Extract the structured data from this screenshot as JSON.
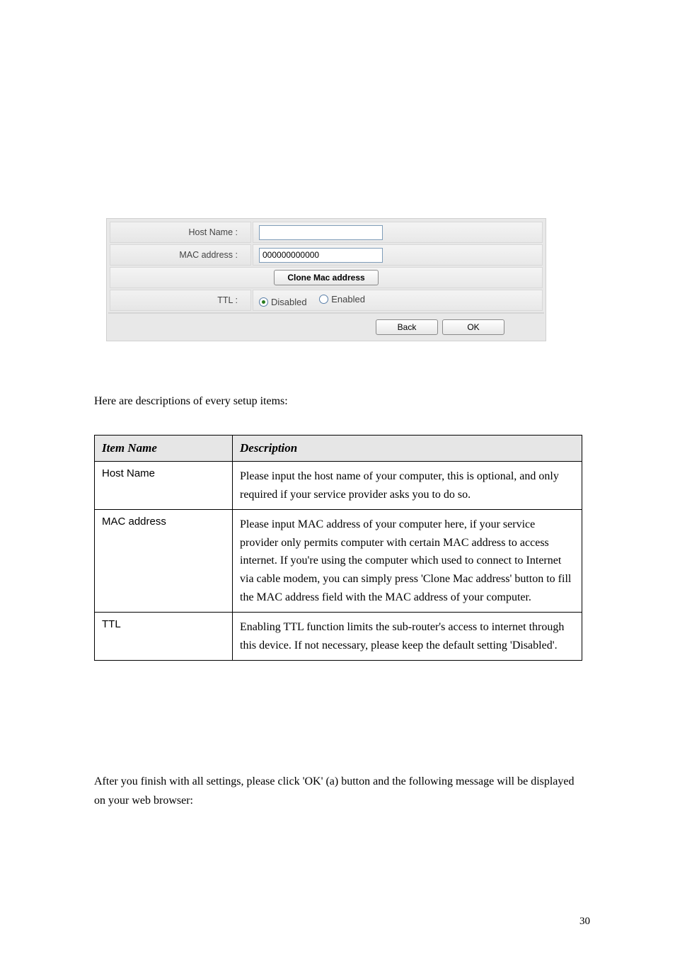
{
  "form": {
    "host_name_label": "Host Name :",
    "host_name_value": "",
    "mac_label": "MAC address :",
    "mac_value": "000000000000",
    "clone_button": "Clone Mac address",
    "ttl_label": "TTL :",
    "ttl_disabled": "Disabled",
    "ttl_enabled": "Enabled",
    "ttl_selected": "disabled",
    "back_button": "Back",
    "ok_button": "OK"
  },
  "intro": "Here are descriptions of every setup items:",
  "table": {
    "headers": {
      "item": "Item Name",
      "desc": "Description"
    },
    "rows": [
      {
        "item": "Host Name",
        "desc": "Please input the host name of your computer, this is optional, and only required if your service provider asks you to do so."
      },
      {
        "item": "MAC address",
        "desc": "Please input MAC address of your computer here, if your service provider only permits computer with certain MAC address to access internet. If you're using the computer which used to connect to Internet via cable modem, you can simply press 'Clone Mac address' button to fill the MAC address field with the MAC address of your computer."
      },
      {
        "item": "TTL",
        "desc": "Enabling TTL function limits the sub-router's access to internet through this device. If not necessary, please keep the default setting 'Disabled'."
      }
    ]
  },
  "ok_sentence": "After you finish with all settings, please click 'OK' (a) button and the following message will be displayed on your web browser:",
  "page_number": "30"
}
